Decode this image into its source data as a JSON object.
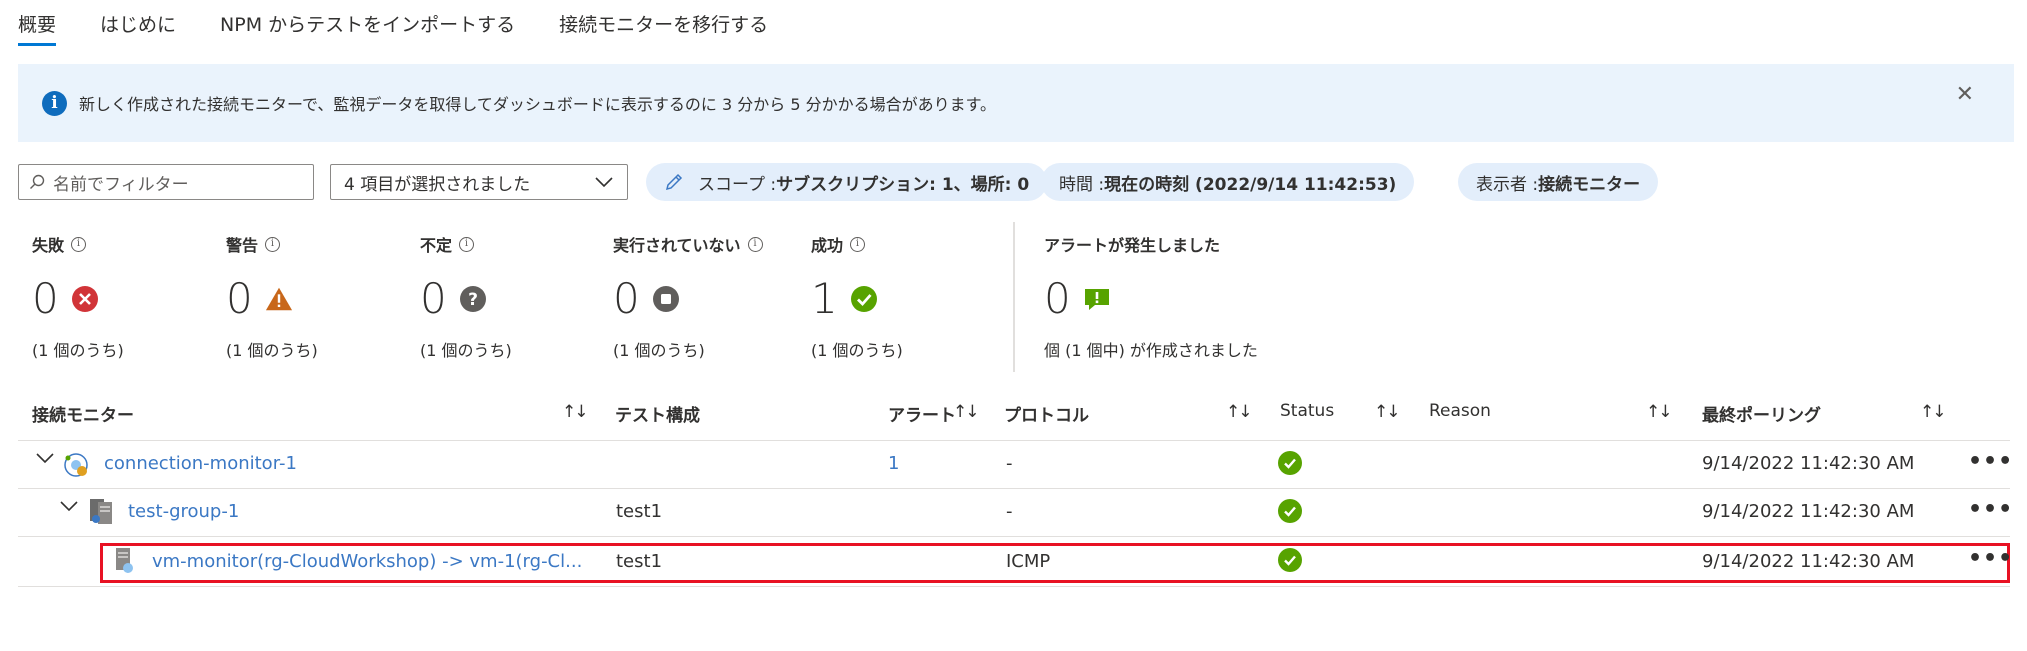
{
  "tabs": [
    {
      "label": "概要"
    },
    {
      "label": "はじめに"
    },
    {
      "label": "NPM からテストをインポートする"
    },
    {
      "label": "接続モニターを移行する"
    }
  ],
  "banner": {
    "text": "新しく作成された接続モニターで、監視データを取得してダッシュボードに表示するのに 3 分から 5 分かかる場合があります。"
  },
  "filter": {
    "placeholder": "名前でフィルター",
    "select_value": "4 項目が選択されました"
  },
  "pills": {
    "scope_label": "スコープ : ",
    "scope_value": "サブスクリプション: 1、場所: 0",
    "time_label": "時間 : ",
    "time_value": "現在の時刻 (2022/9/14 11:42:53)",
    "view_label": "表示者 : ",
    "view_value": "接続モニター"
  },
  "stats": [
    {
      "title": "失敗",
      "value": "0",
      "sub": "(1 個のうち)",
      "icon": "error-icon"
    },
    {
      "title": "警告",
      "value": "0",
      "sub": "(1 個のうち)",
      "icon": "warning-icon"
    },
    {
      "title": "不定",
      "value": "0",
      "sub": "(1 個のうち)",
      "icon": "question-icon"
    },
    {
      "title": "実行されていない",
      "value": "0",
      "sub": "(1 個のうち)",
      "icon": "stop-icon"
    },
    {
      "title": "成功",
      "value": "1",
      "sub": "(1 個のうち)",
      "icon": "check-icon"
    }
  ],
  "alerts": {
    "title": "アラートが発生しました",
    "value": "0",
    "sub": "個 (1 個中) が作成されました"
  },
  "table": {
    "columns": {
      "monitor": "接続モニター",
      "test_config": "テスト構成",
      "alert": "アラート",
      "protocol": "プロトコル",
      "status": "Status",
      "reason": "Reason",
      "last_poll": "最終ポーリング"
    },
    "rows": [
      {
        "name": "connection-monitor-1",
        "test_config": "",
        "alert": "1",
        "protocol": "-",
        "last_poll": "9/14/2022 11:42:30 AM"
      },
      {
        "name": "test-group-1",
        "test_config": "test1",
        "alert": "",
        "protocol": "-",
        "last_poll": "9/14/2022 11:42:30 AM"
      },
      {
        "name": "vm-monitor(rg-CloudWorkshop) -> vm-1(rg-Cl...",
        "test_config": "test1",
        "alert": "",
        "protocol": "ICMP",
        "last_poll": "9/14/2022 11:42:30 AM"
      }
    ],
    "sort_glyph": "↑↓",
    "more_glyph": "•••"
  },
  "colors": {
    "accent": "#0078d4",
    "banner_bg": "#eaf3fc",
    "pill_bg": "#e3eefb",
    "error": "#d13438",
    "warning": "#c8671a",
    "success": "#57a300",
    "highlight": "#e81123"
  }
}
